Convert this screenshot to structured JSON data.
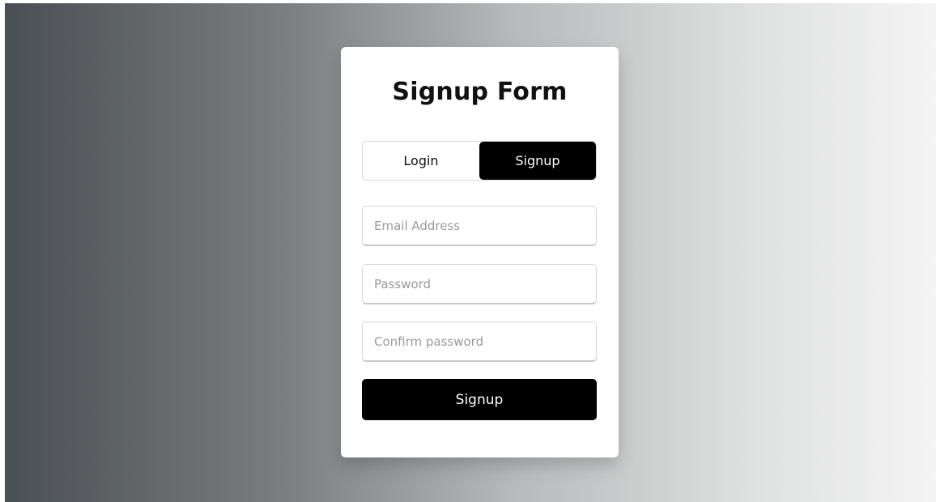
{
  "form": {
    "title": "Signup Form",
    "tabs": [
      {
        "label": "Login",
        "active": false
      },
      {
        "label": "Signup",
        "active": true
      }
    ],
    "fields": {
      "email": {
        "placeholder": "Email Address",
        "value": ""
      },
      "password": {
        "placeholder": "Password",
        "value": ""
      },
      "confirm": {
        "placeholder": "Confirm password",
        "value": ""
      }
    },
    "submit_label": "Signup"
  },
  "colors": {
    "accent": "#000000",
    "card": "#ffffff",
    "gradient_start": "#4a4f53",
    "gradient_end": "#f4f4f4"
  }
}
